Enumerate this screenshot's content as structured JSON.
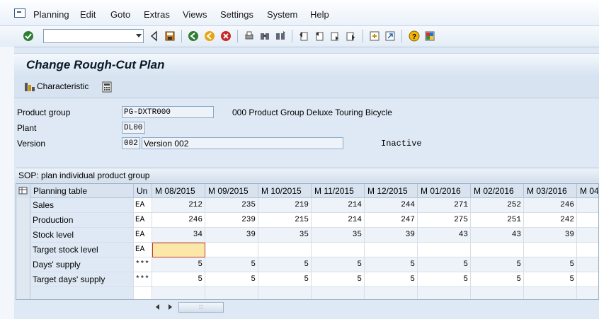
{
  "menu": {
    "items": [
      "Planning",
      "Edit",
      "Goto",
      "Extras",
      "Views",
      "Settings",
      "System",
      "Help"
    ]
  },
  "toolbar": {
    "command_field": "",
    "icons": [
      "enter-icon",
      "back-arrow-icon",
      "save-icon",
      "back-icon",
      "exit-icon",
      "cancel-icon",
      "print-icon",
      "find-icon",
      "find-next-icon",
      "first-page-icon",
      "prev-page-icon",
      "next-page-icon",
      "last-page-icon",
      "create-session-icon",
      "shortcut-icon",
      "help-icon",
      "customize-layout-icon"
    ]
  },
  "title": "Change Rough-Cut Plan",
  "app_toolbar": {
    "characteristic_label": "Characteristic"
  },
  "form": {
    "product_group_label": "Product group",
    "product_group_value": "PG-DXTR000",
    "product_group_desc": "000 Product Group Deluxe Touring Bicycle",
    "plant_label": "Plant",
    "plant_value": "DL00",
    "version_label": "Version",
    "version_value": "002",
    "version_desc": "Version 002",
    "status": "Inactive"
  },
  "table": {
    "title": "SOP: plan individual product group",
    "header_label": "Planning table",
    "header_unit": "Un",
    "periods": [
      "M 08/2015",
      "M 09/2015",
      "M 10/2015",
      "M 11/2015",
      "M 12/2015",
      "M 01/2016",
      "M 02/2016",
      "M 03/2016",
      "M 04"
    ],
    "rows": [
      {
        "label": "Sales",
        "unit": "EA",
        "values": [
          "212",
          "235",
          "219",
          "214",
          "244",
          "271",
          "252",
          "246",
          ""
        ]
      },
      {
        "label": "Production",
        "unit": "EA",
        "values": [
          "246",
          "239",
          "215",
          "214",
          "247",
          "275",
          "251",
          "242",
          ""
        ]
      },
      {
        "label": "Stock level",
        "unit": "EA",
        "values": [
          "34",
          "39",
          "35",
          "35",
          "39",
          "43",
          "43",
          "39",
          ""
        ]
      },
      {
        "label": "Target stock level",
        "unit": "EA",
        "values": [
          "",
          "",
          "",
          "",
          "",
          "",
          "",
          "",
          ""
        ]
      },
      {
        "label": "Days' supply",
        "unit": "***",
        "values": [
          "5",
          "5",
          "5",
          "5",
          "5",
          "5",
          "5",
          "5",
          ""
        ]
      },
      {
        "label": "Target days' supply",
        "unit": "***",
        "values": [
          "5",
          "5",
          "5",
          "5",
          "5",
          "5",
          "5",
          "5",
          ""
        ]
      }
    ]
  },
  "colors": {
    "background": "#dfe9f5",
    "header": "#d8e3ef",
    "active_cell": "#fbe8a8",
    "active_border": "#c0392b"
  }
}
